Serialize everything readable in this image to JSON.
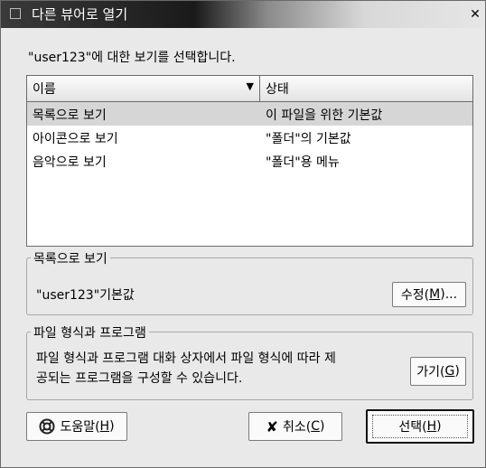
{
  "window": {
    "title": "다른 뷰어로 열기"
  },
  "prompt": "\"user123\"에 대한 보기를 선택합니다.",
  "list": {
    "columns": [
      "이름",
      "상태"
    ],
    "rows": [
      {
        "name": "목록으로 보기",
        "status": "이 파일을 위한 기본값"
      },
      {
        "name": "아이콘으로 보기",
        "status": "\"폴더\"의 기본값"
      },
      {
        "name": "음악으로 보기",
        "status": "\"폴더\"용 메뉴"
      }
    ],
    "selected_index": 0
  },
  "view_group": {
    "title": "목록으로 보기",
    "text": "\"user123\"기본값",
    "edit_button": {
      "label": "수정(",
      "mnemonic": "M",
      "suffix": ")..."
    }
  },
  "program_group": {
    "title": "파일 형식과 프로그램",
    "text_line1": "파일 형식과 프로그램 대화 상자에서 파일 형식에 따라 제",
    "text_line2": "공되는 프로그램을 구성할 수 있습니다.",
    "goto_button": {
      "label": "가기(",
      "mnemonic": "G",
      "suffix": ")"
    }
  },
  "buttons": {
    "help": {
      "label": "도움말(",
      "mnemonic": "H",
      "suffix": ")",
      "icon": "help-icon"
    },
    "cancel": {
      "label": "취소(",
      "mnemonic": "C",
      "suffix": ")",
      "icon": "cancel-x-icon"
    },
    "select": {
      "label": "선택(",
      "mnemonic": "H",
      "suffix": ")"
    }
  }
}
